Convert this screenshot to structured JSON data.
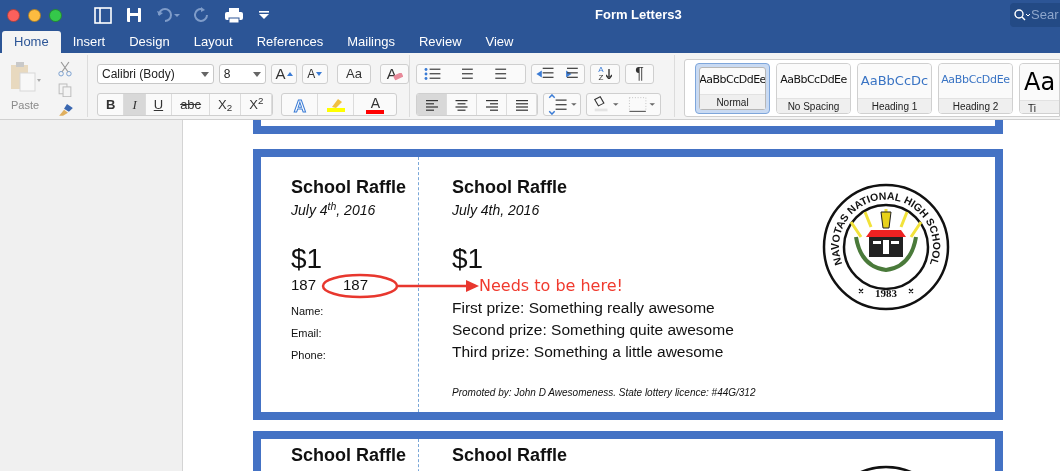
{
  "window": {
    "title": "Form Letters3",
    "search_placeholder": "Sear"
  },
  "tabs": [
    {
      "label": "Home",
      "selected": true
    },
    {
      "label": "Insert",
      "selected": false
    },
    {
      "label": "Design",
      "selected": false
    },
    {
      "label": "Layout",
      "selected": false
    },
    {
      "label": "References",
      "selected": false
    },
    {
      "label": "Mailings",
      "selected": false
    },
    {
      "label": "Review",
      "selected": false
    },
    {
      "label": "View",
      "selected": false
    }
  ],
  "ribbon": {
    "paste_label": "Paste",
    "font_name": "Calibri (Body)",
    "font_size": "8",
    "font_tools": [
      {
        "kind": "grow",
        "label": "A"
      },
      {
        "kind": "shrink",
        "label": "A"
      },
      {
        "kind": "case",
        "label": "Aa"
      },
      {
        "kind": "clear",
        "label": "A"
      }
    ],
    "format_buttons": [
      {
        "kind": "bold",
        "label": "B",
        "selected": false
      },
      {
        "kind": "italic",
        "label": "I",
        "selected": true
      },
      {
        "kind": "underline",
        "label": "U",
        "selected": false
      },
      {
        "kind": "strike",
        "label": "abc",
        "selected": false
      },
      {
        "kind": "plain",
        "label": "X$_{2}$",
        "selected": false
      },
      {
        "kind": "plain",
        "label": "X$^{2}$",
        "selected": false
      }
    ],
    "color_tools": [
      {
        "kind": "effects",
        "label": "A"
      },
      {
        "kind": "highlight",
        "color": "#ffff00"
      },
      {
        "kind": "fontcolor",
        "label": "A",
        "color": "#ff0000"
      }
    ],
    "sort": {
      "top": "A",
      "bottom": "Z"
    },
    "pilcrow": "¶",
    "alignment": [
      {
        "kind": "left",
        "selected": true
      },
      {
        "kind": "center",
        "selected": false
      },
      {
        "kind": "right",
        "selected": false
      },
      {
        "kind": "justify",
        "selected": false
      }
    ],
    "styles": [
      {
        "preview": "AaBbCcDdEe",
        "name": "Normal",
        "kind": "body",
        "selected": true
      },
      {
        "preview": "AaBbCcDdEe",
        "name": "No Spacing",
        "kind": "body",
        "selected": false
      },
      {
        "preview": "AaBbCcDc",
        "name": "Heading 1",
        "kind": "heading1",
        "selected": false
      },
      {
        "preview": "AaBbCcDdEe",
        "name": "Heading 2",
        "kind": "heading2",
        "selected": false
      },
      {
        "preview": "Aa",
        "name": "Ti",
        "kind": "title",
        "selected": false
      }
    ]
  },
  "tickets": [
    {
      "stub": {
        "title": "School Raffle",
        "date": "July 4$^{th}$, 2016",
        "price": "$1",
        "numbers": [
          "187",
          "187"
        ],
        "fields": [
          "Name:",
          "Email:",
          "Phone:"
        ]
      },
      "main": {
        "title": "School Raffle",
        "date": "July 4th, 2016",
        "price": "$1",
        "note": "Needs to be here!",
        "prizes": [
          "First prize: Something really awesome",
          "Second prize: Something quite awesome",
          "Third prize: Something a little awesome"
        ],
        "promoter": "Promoted by: John D Awesomeness. State lottery licence: #44G/312"
      },
      "seal": {
        "name": "NAVOTAS NATIONAL HIGH SCHOOL",
        "year": "1983"
      }
    },
    {
      "stub": {
        "title": "School Raffle"
      },
      "main": {
        "title": "School Raffle"
      }
    }
  ]
}
